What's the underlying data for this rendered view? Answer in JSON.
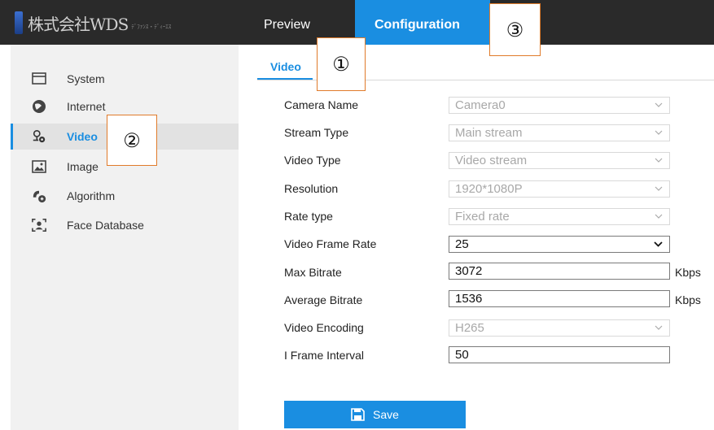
{
  "header": {
    "logo_text": "株式会社WDS",
    "logo_subtext": "ﾃﾞﾌｧﾝｽ・ﾃﾞｨｰｴｽ",
    "tabs": [
      {
        "label": "Preview"
      },
      {
        "label": "Configuration"
      }
    ]
  },
  "sidebar": {
    "items": [
      {
        "label": "System",
        "icon": "monitor-icon"
      },
      {
        "label": "Internet",
        "icon": "globe-icon"
      },
      {
        "label": "Video",
        "icon": "camera-icon"
      },
      {
        "label": "Image",
        "icon": "image-icon"
      },
      {
        "label": "Algorithm",
        "icon": "algorithm-icon"
      },
      {
        "label": "Face Database",
        "icon": "face-icon"
      }
    ],
    "active": "Video"
  },
  "main": {
    "subtab": "Video",
    "form": [
      {
        "label": "Camera Name",
        "value": "Camera0",
        "type": "select",
        "enabled": false
      },
      {
        "label": "Stream Type",
        "value": "Main stream",
        "type": "select",
        "enabled": false
      },
      {
        "label": "Video Type",
        "value": "Video stream",
        "type": "select",
        "enabled": false
      },
      {
        "label": "Resolution",
        "value": "1920*1080P",
        "type": "select",
        "enabled": false
      },
      {
        "label": "Rate type",
        "value": "Fixed rate",
        "type": "select",
        "enabled": false
      },
      {
        "label": "Video Frame Rate",
        "value": "25",
        "type": "select",
        "enabled": true
      },
      {
        "label": "Max Bitrate",
        "value": "3072",
        "type": "text",
        "enabled": true,
        "unit": "Kbps"
      },
      {
        "label": "Average Bitrate",
        "value": "1536",
        "type": "text",
        "enabled": true,
        "unit": "Kbps"
      },
      {
        "label": "Video Encoding",
        "value": "H265",
        "type": "select",
        "enabled": false
      },
      {
        "label": "I Frame Interval",
        "value": "50",
        "type": "text",
        "enabled": true
      }
    ],
    "save_label": "Save"
  },
  "callouts": [
    "①",
    "②",
    "③"
  ],
  "colors": {
    "accent": "#1a8ee1",
    "topbar": "#2a2a2a",
    "sidebar": "#f1f1f1",
    "callout_border": "#e07b2a"
  }
}
